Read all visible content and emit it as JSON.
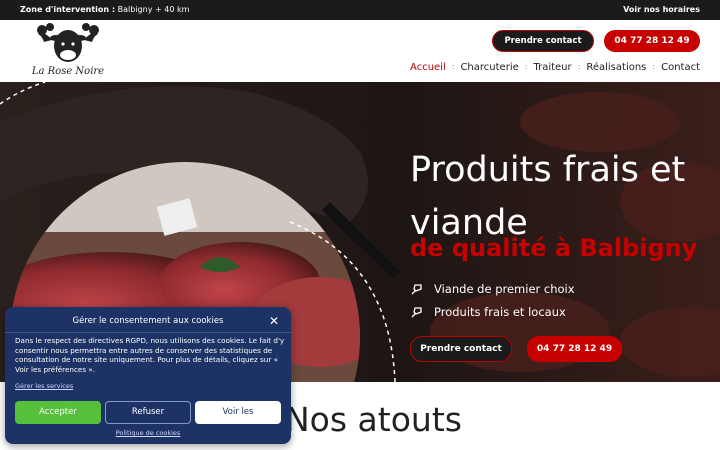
{
  "topbar": {
    "zone_label": "Zone d'intervention :",
    "zone_value": "Balbigny + 40 km",
    "hours_link": "Voir nos horaires"
  },
  "header": {
    "logo_text": "La Rose Noire",
    "contact_button": "Prendre contact",
    "phone_button": "04 77 28 12 49",
    "nav": [
      "Accueil",
      "Charcuterie",
      "Traiteur",
      "Réalisations",
      "Contact"
    ]
  },
  "hero": {
    "title": "Produits frais et viande",
    "subtitle": "de qualité à Balbigny",
    "features": [
      "Viande de premier choix",
      "Produits frais et locaux"
    ],
    "contact_button": "Prendre contact",
    "phone_button": "04 77 28 12 49"
  },
  "section": {
    "title": "Nos atouts"
  },
  "cookie": {
    "title": "Gérer le consentement aux cookies",
    "close": "✕",
    "text": "Dans le respect des directives RGPD, nous utilisons des cookies. Le fait d'y consentir nous permettra entre autres de conserver des statistiques de consultation de notre site uniquement. Pour plus de détails, cliquez sur « Voir les préférences ».",
    "manage_link": "Gérer les services",
    "accept": "Accepter",
    "refuse": "Refuser",
    "preferences": "Voir les préférences",
    "policy_link": "Politique de cookies"
  },
  "colors": {
    "accent_red": "#c70000",
    "dark": "#1b1b1b",
    "cookie_bg": "#1e3365",
    "accept_green": "#57c03b"
  },
  "icons": [
    "cow-logo-icon",
    "cleaver-icon"
  ]
}
